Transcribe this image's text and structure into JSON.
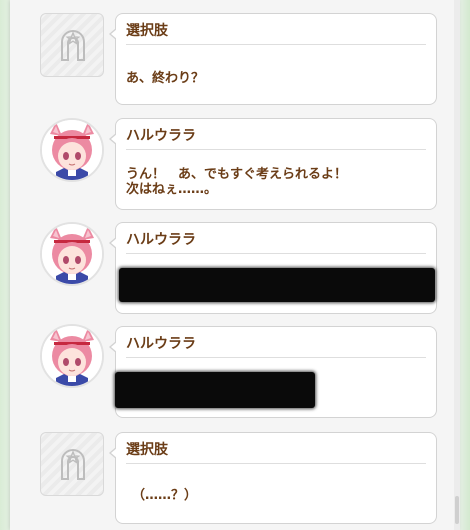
{
  "dialogue": [
    {
      "speaker": "選択肢",
      "text": "あ、終わり？",
      "avatar": "choice-icon"
    },
    {
      "speaker": "ハルウララ",
      "text": "うん！　あ、でもすぐ考えられるよ！\n次はねぇ……。",
      "avatar": "haru-urara-portrait"
    },
    {
      "speaker": "ハルウララ",
      "text": "",
      "avatar": "haru-urara-portrait",
      "redacted": true
    },
    {
      "speaker": "ハルウララ",
      "text": "",
      "avatar": "haru-urara-portrait",
      "redacted": true
    },
    {
      "speaker": "選択肢",
      "text": "（……？）",
      "avatar": "choice-icon"
    }
  ],
  "colors": {
    "speaker_text": "#6b3d17",
    "hair_pink": "#ec8aa2",
    "headband_red": "#c6283f"
  }
}
